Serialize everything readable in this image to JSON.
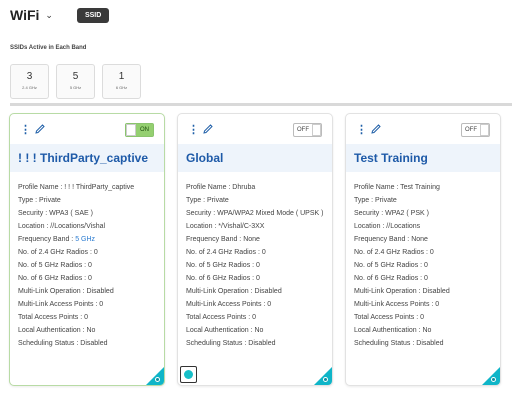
{
  "header": {
    "title": "WiFi",
    "ssid_badge": "SSID"
  },
  "section_label": "SSIDs Active in Each Band",
  "stats": [
    {
      "value": "3",
      "label": "2.4 GHz"
    },
    {
      "value": "5",
      "label": "5 GHz"
    },
    {
      "value": "1",
      "label": "6 GHz"
    }
  ],
  "cards": [
    {
      "toggle": "ON",
      "name": "! ! ! ThirdParty_captive",
      "props": [
        "Profile Name : ! ! ! ThirdParty_captive",
        "Type : Private",
        "Security : WPA3 ( SAE )",
        "Location : //Locations/Vishal",
        "Frequency Band : ",
        "No. of 2.4 GHz Radios : 0",
        "No. of 5 GHz Radios : 0",
        "No. of 6 GHz Radios : 0",
        "Multi-Link Operation : Disabled",
        "Multi-Link Access Points : 0",
        "Total Access Points : 0",
        "Local Authentication : No",
        "Scheduling Status : Disabled"
      ],
      "freq_link": "5 GHz"
    },
    {
      "toggle": "OFF",
      "name": "Global",
      "props": [
        "Profile Name : Dhruba",
        "Type : Private",
        "Security : WPA/WPA2 Mixed Mode ( UPSK )",
        "Location : */Vishal/C-3XX",
        "Frequency Band : None",
        "No. of 2.4 GHz Radios : 0",
        "No. of 5 GHz Radios : 0",
        "No. of 6 GHz Radios : 0",
        "Multi-Link Operation : Disabled",
        "Multi-Link Access Points : 0",
        "Total Access Points : 0",
        "Local Authentication : No",
        "Scheduling Status : Disabled"
      ]
    },
    {
      "toggle": "OFF",
      "name": "Test Training",
      "props": [
        "Profile Name : Test Training",
        "Type : Private",
        "Security : WPA2 ( PSK )",
        "Location : //Locations",
        "Frequency Band : None",
        "No. of 2.4 GHz Radios : 0",
        "No. of 5 GHz Radios : 0",
        "No. of 6 GHz Radios : 0",
        "Multi-Link Operation : Disabled",
        "Multi-Link Access Points : 0",
        "Total Access Points : 0",
        "Local Authentication : No",
        "Scheduling Status : Disabled"
      ]
    }
  ],
  "colors": {
    "accent": "#1e5aa8",
    "corner": "#0fb5c8",
    "on_toggle": "#94cf70"
  }
}
